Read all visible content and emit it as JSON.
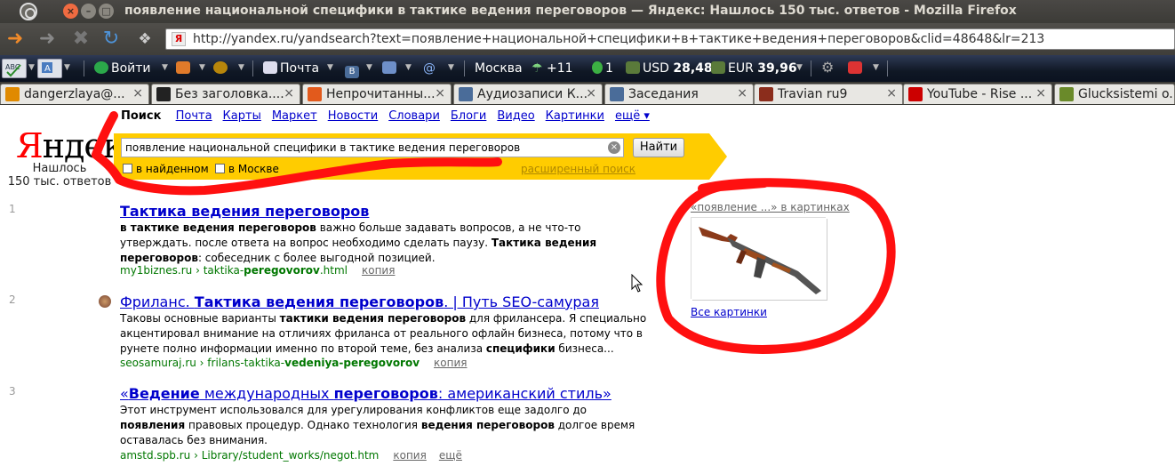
{
  "window": {
    "title": "появление национальной специфики в тактике ведения переговоров — Яндекс: Нашлось 150 тыс. ответов - Mozilla Firefox"
  },
  "nav": {
    "url": "http://yandex.ru/yandsearch?text=появление+национальной+специфики+в+тактике+ведения+переговоров&clid=48648&lr=213",
    "favicon": "Я"
  },
  "toolbar": {
    "login": "Войти",
    "mail": "Почта",
    "city": "Москва",
    "weather": "+11",
    "points": "1",
    "usd_label": "USD",
    "usd_value": "28,48",
    "eur_label": "EUR",
    "eur_value": "39,96"
  },
  "tabs": [
    {
      "label": "dangerzlaya@...",
      "icon": "at-icon",
      "color": "#e08a00"
    },
    {
      "label": "Без заголовка....",
      "icon": "li-icon",
      "color": "#222"
    },
    {
      "label": "Непрочитанны...",
      "icon": "ubuntu-icon",
      "color": "#e25a1c"
    },
    {
      "label": "Аудиозаписи К...",
      "icon": "play-icon",
      "color": "#4a6c99"
    },
    {
      "label": "Заседания",
      "icon": "vk-icon",
      "color": "#4a6c99"
    },
    {
      "label": "Travian ru9",
      "icon": "travian-icon",
      "color": "#8b2d1c"
    },
    {
      "label": "YouTube - Rise ...",
      "icon": "youtube-icon",
      "color": "#c00"
    },
    {
      "label": "Glucksistemi o...",
      "icon": "page-icon",
      "color": "#6a8a2a"
    }
  ],
  "services": {
    "active": "Поиск",
    "items": [
      "Почта",
      "Карты",
      "Маркет",
      "Новости",
      "Словари",
      "Блоги",
      "Видео",
      "Картинки"
    ],
    "more": "ещё ▾"
  },
  "logo": {
    "first": "Я",
    "rest": "ндекс"
  },
  "found": {
    "line1": "Нашлось",
    "line2": "150 тыс. ответов"
  },
  "search": {
    "query": "появление национальной специфики в тактике ведения переговоров",
    "button": "Найти",
    "opt_found": "в найденном",
    "opt_moscow": "в Москве",
    "advanced": "расширенный поиск"
  },
  "results": [
    {
      "num": "1",
      "title_html_parts": [
        {
          "t": "Тактика ведения переговоров",
          "b": true
        }
      ],
      "snippet": [
        {
          "t": "в тактике ведения переговоров",
          "b": true
        },
        {
          "t": " важно больше задавать вопросов, а не что-то утверждать. после ответа на вопрос необходимо сделать паузу. ",
          "b": false
        },
        {
          "t": "Тактика ведения переговоров",
          "b": true
        },
        {
          "t": ": собеседник с более выгодной позицией.",
          "b": false
        }
      ],
      "url_parts": [
        {
          "t": "my1biznes.ru › taktika-",
          "b": false
        },
        {
          "t": "peregovorov",
          "b": true
        },
        {
          "t": ".html",
          "b": false
        }
      ],
      "copy": "копия",
      "more": ""
    },
    {
      "num": "2",
      "title_html_parts": [
        {
          "t": "Фриланс. ",
          "b": false
        },
        {
          "t": "Тактика ведения переговоров",
          "b": true
        },
        {
          "t": ". | Путь SEO-самурая",
          "b": false
        }
      ],
      "snippet": [
        {
          "t": "Таковы основные варианты ",
          "b": false
        },
        {
          "t": "тактики ведения переговоров",
          "b": true
        },
        {
          "t": " для фрилансера. Я специально акцентировал внимание на отличиях фриланса от реального офлайн бизнеса, потому что в рунете полно информации именно по второй теме, без анализа ",
          "b": false
        },
        {
          "t": "специфики",
          "b": true
        },
        {
          "t": " бизнеса...",
          "b": false
        }
      ],
      "url_parts": [
        {
          "t": "seosamuraj.ru › frilans-taktika-",
          "b": false
        },
        {
          "t": "vedeniya-peregovorov",
          "b": true
        }
      ],
      "copy": "копия",
      "more": ""
    },
    {
      "num": "3",
      "title_html_parts": [
        {
          "t": "«",
          "b": false
        },
        {
          "t": "Ведение",
          "b": true
        },
        {
          "t": " международных ",
          "b": false
        },
        {
          "t": "переговоров",
          "b": true
        },
        {
          "t": ": американский стиль»",
          "b": false
        }
      ],
      "snippet": [
        {
          "t": "Этот инструмент использовался для урегулирования конфликтов еще задолго до ",
          "b": false
        },
        {
          "t": "появления",
          "b": true
        },
        {
          "t": " правовых процедур. Однако технология ",
          "b": false
        },
        {
          "t": "ведения переговоров",
          "b": true
        },
        {
          "t": " долгое время оставалась без внимания.",
          "b": false
        }
      ],
      "url_parts": [
        {
          "t": "amstd.spb.ru › Library/student_works/negot.htm",
          "b": false
        }
      ],
      "copy": "копия",
      "more": "ещё"
    }
  ],
  "images": {
    "heading": "«появление ...» в картинках",
    "all": "Все картинки"
  },
  "colors": {
    "yandex_yellow": "#ffcc00",
    "link": "#0000cc",
    "url_green": "#007700",
    "annotation_red": "#ff0000"
  }
}
